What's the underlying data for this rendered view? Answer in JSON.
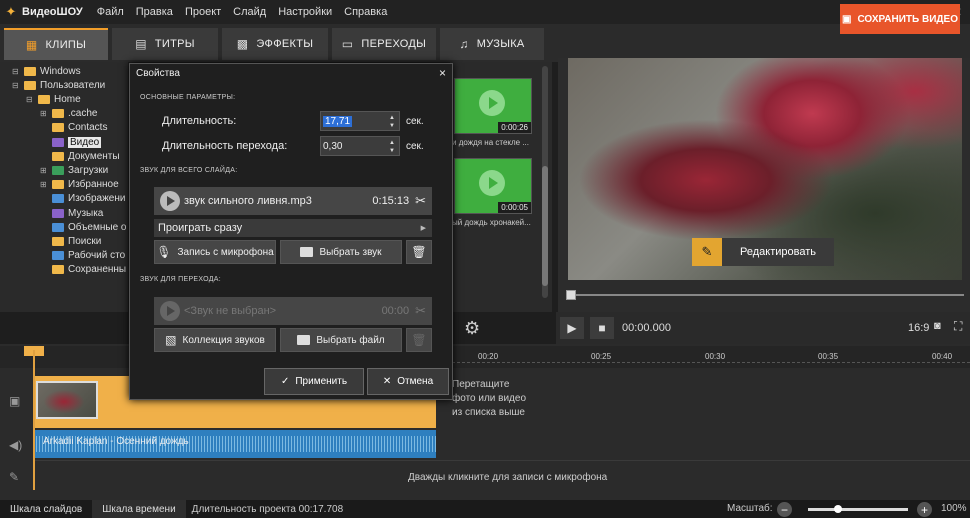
{
  "app": {
    "name": "ВидеоШОУ"
  },
  "menu": [
    "Файл",
    "Правка",
    "Проект",
    "Слайд",
    "Настройки",
    "Справка"
  ],
  "tabs": [
    {
      "label": "КЛИПЫ",
      "icon": "film-icon",
      "active": true
    },
    {
      "label": "ТИТРЫ",
      "icon": "titles-icon",
      "active": false
    },
    {
      "label": "ЭФФЕКТЫ",
      "icon": "effects-icon",
      "active": false
    },
    {
      "label": "ПЕРЕХОДЫ",
      "icon": "transitions-icon",
      "active": false
    },
    {
      "label": "МУЗЫКА",
      "icon": "music-icon",
      "active": false
    }
  ],
  "save_button": "СОХРАНИТЬ ВИДЕО",
  "tree": [
    {
      "label": "Windows",
      "color": "yellow"
    },
    {
      "label": "Пользователи",
      "color": "yellow"
    },
    {
      "label": "Home",
      "color": "yellow"
    },
    {
      "label": ".cache",
      "color": "yellow"
    },
    {
      "label": "Contacts",
      "color": "yellow"
    },
    {
      "label": "Видео",
      "color": "purple",
      "selected": true
    },
    {
      "label": "Документы",
      "color": "yellow"
    },
    {
      "label": "Загрузки",
      "color": "green"
    },
    {
      "label": "Избранное",
      "color": "yellow"
    },
    {
      "label": "Изображени",
      "color": "blue"
    },
    {
      "label": "Музыка",
      "color": "purple"
    },
    {
      "label": "Объемные о",
      "color": "blue"
    },
    {
      "label": "Поиски",
      "color": "yellow"
    },
    {
      "label": "Рабочий сто",
      "color": "blue"
    },
    {
      "label": "Сохраненны",
      "color": "yellow"
    }
  ],
  "media": [
    {
      "duration": "0:00:26",
      "caption": "и дождя на стекле ..."
    },
    {
      "duration": "0:00:05",
      "caption": "ый дождь хронакей..."
    }
  ],
  "dialog": {
    "title": "Свойства",
    "close": "×",
    "main_section": "ОСНОВНЫЕ ПАРАМЕТРЫ:",
    "duration_label": "Длительность:",
    "duration_value": "17,71",
    "transition_label": "Длительность перехода:",
    "transition_value": "0,30",
    "unit": "сек.",
    "slide_sound_section": "ЗВУК ДЛЯ ВСЕГО СЛАЙДА:",
    "sound_name": "звук сильного ливня.mp3",
    "sound_duration": "0:15:13",
    "play_mode": "Проиграть сразу",
    "mic_button": "Запись с микрофона",
    "choose_sound_button": "Выбрать звук",
    "transition_sound_section": "ЗВУК ДЛЯ ПЕРЕХОДА:",
    "no_sound": "<Звук не выбран>",
    "no_sound_duration": "00:00",
    "collection_button": "Коллекция звуков",
    "choose_file_button": "Выбрать файл",
    "apply_button": "Применить",
    "cancel_button": "Отмена"
  },
  "preview": {
    "edit_button": "Редактировать",
    "time": "00:00.000",
    "ratio": "16:9"
  },
  "timeline": {
    "ticks": [
      "00:20",
      "00:25",
      "00:30",
      "00:35",
      "00:40"
    ],
    "drop_hint": [
      "Перетащите",
      "фото или видео",
      "из списка выше"
    ],
    "audio_label": "Arkadii Kaplan - Осенний дождь",
    "mic_hint": "Дважды кликните для записи с микрофона"
  },
  "status": {
    "slides_tab": "Шкала слайдов",
    "time_tab": "Шкала времени",
    "project_duration": "Длительность проекта 00:17.708",
    "zoom_label": "Масштаб:",
    "zoom_value": "100%",
    "zoom_level": 0.3
  },
  "colors": {
    "accent": "#f29e2a",
    "save": "#e8552a",
    "video_track": "#f0b049",
    "audio_track": "#2e7fbf",
    "thumb_green": "#3fae3f"
  }
}
